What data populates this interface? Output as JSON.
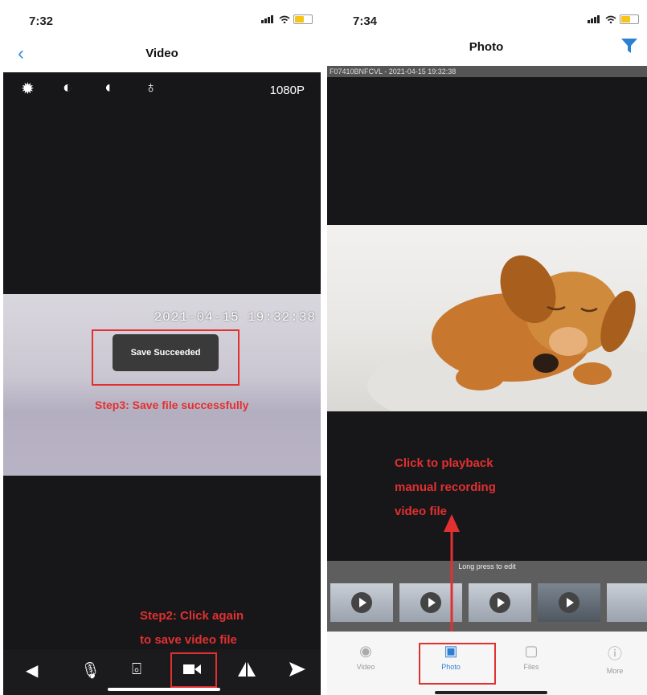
{
  "left": {
    "status_time": "7:32",
    "nav_title": "Video",
    "resolution": "1080P",
    "controls": [
      "brightness-icon",
      "contrast-icon",
      "saturation-icon",
      "light-icon"
    ],
    "overlay_timestamp": "2021-04-15 19:32:38",
    "toast": "Save Succeeded",
    "step3_text": "Step3: Save file successfully",
    "step2_line1": "Step2: Click again",
    "step2_line2": "to save video file",
    "toolbar": [
      "speaker-icon",
      "microphone-icon",
      "snapshot-icon",
      "record-icon",
      "flip-icon",
      "mirror-icon"
    ]
  },
  "right": {
    "status_time": "7:34",
    "nav_title": "Photo",
    "device_timestamp": "F07410BNFCVL - 2021-04-15 19:32:38",
    "annotation_line1": "Click to playback",
    "annotation_line2": "manual recording",
    "annotation_line3": "video file",
    "strip_hint": "Long press to edit",
    "tabs": [
      {
        "label": "Video",
        "icon": "camera-icon"
      },
      {
        "label": "Photo",
        "icon": "photo-icon"
      },
      {
        "label": "Files",
        "icon": "files-icon"
      },
      {
        "label": "More",
        "icon": "more-icon"
      }
    ]
  },
  "colors": {
    "annotation_red": "#e23030",
    "accent_blue": "#2d7fd3",
    "battery_yellow": "#f5c518"
  }
}
